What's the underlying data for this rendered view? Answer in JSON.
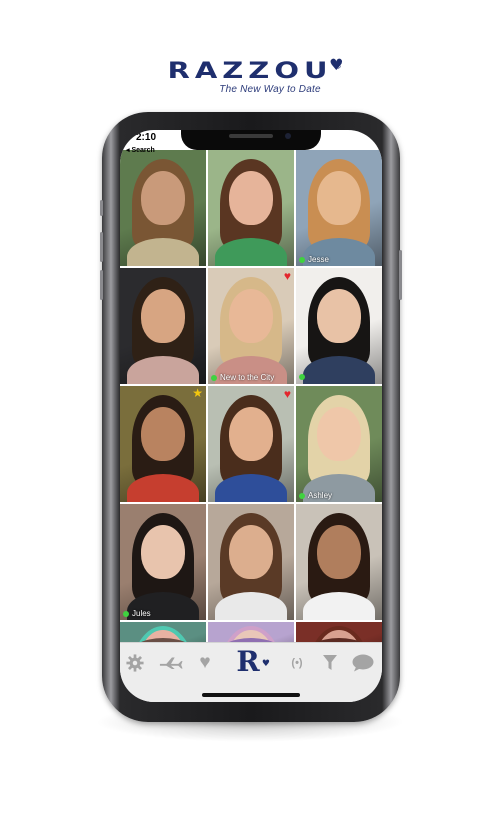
{
  "brand": {
    "logo": "RAZZOU",
    "tagline": "The New Way to Date",
    "registered": "®"
  },
  "status_bar": {
    "time": "2:10",
    "back_label": "◂ Search"
  },
  "grid": [
    {
      "name": "",
      "online": false,
      "badge": "",
      "skin": "#c99a7a",
      "hair": "#7a5634",
      "bg": "#5e7b4e",
      "top": "#c2b48f"
    },
    {
      "name": "",
      "online": false,
      "badge": "",
      "skin": "#e6b49a",
      "hair": "#5a3622",
      "bg": "#9bb589",
      "top": "#3f9a5a"
    },
    {
      "name": "Jesse",
      "online": true,
      "badge": "",
      "skin": "#e6b88e",
      "hair": "#c98e52",
      "bg": "#8fa4b8",
      "top": "#6e8aa0"
    },
    {
      "name": "",
      "online": false,
      "badge": "",
      "skin": "#d7a582",
      "hair": "#2f2116",
      "bg": "#2b2b2e",
      "top": "#c9a49c"
    },
    {
      "name": "New to the City",
      "online": true,
      "badge": "heart",
      "skin": "#e8b897",
      "hair": "#d6b889",
      "bg": "#d9cbb8",
      "top": "#c98f86"
    },
    {
      "name": "",
      "online": true,
      "badge": "",
      "skin": "#e8c2a6",
      "hair": "#171514",
      "bg": "#f1efec",
      "top": "#2f3f5f"
    },
    {
      "name": "",
      "online": false,
      "badge": "star",
      "skin": "#b98360",
      "hair": "#2a1c14",
      "bg": "#7a6e3c",
      "top": "#c63e2f"
    },
    {
      "name": "",
      "online": false,
      "badge": "heart",
      "skin": "#e2b08e",
      "hair": "#4a2d1c",
      "bg": "#b9bfb3",
      "top": "#2e4e9a"
    },
    {
      "name": "Ashley",
      "online": true,
      "badge": "",
      "skin": "#efc7a9",
      "hair": "#e3d3a8",
      "bg": "#6f8b5a",
      "top": "#8e9aa1"
    },
    {
      "name": "Jules",
      "online": true,
      "badge": "",
      "skin": "#e8c4ad",
      "hair": "#1e1714",
      "bg": "#9a7f6f",
      "top": "#202022"
    },
    {
      "name": "",
      "online": false,
      "badge": "",
      "skin": "#dcae8e",
      "hair": "#5a3a26",
      "bg": "#b7a89a",
      "top": "#e9e9e9"
    },
    {
      "name": "",
      "online": false,
      "badge": "",
      "skin": "#b07e5d",
      "hair": "#2a1a12",
      "bg": "#c9c2b8",
      "top": "#f2f2f2"
    },
    {
      "name": "",
      "online": false,
      "badge": "",
      "skin": "#e8b2a2",
      "hair": "#4fc9b1",
      "bg": "#5b8f82",
      "top": "#6a4f46"
    },
    {
      "name": "",
      "online": false,
      "badge": "",
      "skin": "#e9c7b8",
      "hair": "#cfa0c9",
      "bg": "#b7a3cf",
      "top": "#8f6fb1"
    },
    {
      "name": "",
      "online": false,
      "badge": "",
      "skin": "#d8a090",
      "hair": "#6a2a1e",
      "bg": "#7a2f27",
      "top": "#5b2a22"
    }
  ],
  "tabbar": {
    "settings_icon": "gear-icon",
    "travel_icon": "airplane-icon",
    "favorites_icon": "heart-icon",
    "home_icon": "razzou-r-logo",
    "home_glyph": "R",
    "broadcast_icon": "broadcast-icon",
    "broadcast_glyph": "(•)",
    "filter_icon": "filter-icon",
    "chat_icon": "chat-bubble-icon"
  },
  "colors": {
    "brand_navy": "#1f2f6e",
    "online_green": "#3fd33f",
    "heart_red": "#e3262d",
    "star_gold": "#f4c70e",
    "tab_icon_gray": "#a4a4a4",
    "tab_bar_bg": "#ededed"
  }
}
